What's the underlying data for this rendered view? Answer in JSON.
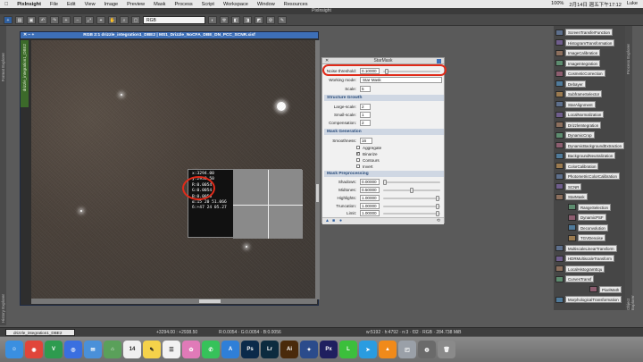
{
  "menubar": {
    "app": "PixInsight",
    "items": [
      "File",
      "Edit",
      "View",
      "Image",
      "Preview",
      "Mask",
      "Process",
      "Script",
      "Workspace",
      "Window",
      "Resources"
    ],
    "clock": "2月14日 週五下午17:12",
    "user": "Luke",
    "battery": "100%"
  },
  "window_title": "PixInsight",
  "toolbar": {
    "channel_select": "RGB"
  },
  "left_strip": {
    "top_label": "Format Explorer",
    "bottom_label": "History Explorer"
  },
  "image_window": {
    "title": "RGB 2:1 drizzle_integration1_DBE2 | MS1_Drizzle_NoCFA_DBE_DN_PCC_SCNR.xisf",
    "side_tab": "drizzle_integration1_DBE2",
    "readout_lines": [
      "x:3294.00",
      "y:2938.50",
      "R:0.0054",
      "G:0.0054",
      "B:0.0056",
      "α:15 20 51.066",
      "δ:+47 24 05.27"
    ]
  },
  "starmask": {
    "title": "StarMask",
    "noise_threshold_label": "Noise threshold:",
    "noise_threshold": "0.10000",
    "working_mode_label": "Working mode:",
    "working_mode": "Star Mask",
    "scale_label": "Scale:",
    "scale": "5",
    "section_structure": "Structure Growth",
    "large_scale_label": "Large-scale:",
    "large_scale": "2",
    "small_scale_label": "Small-scale:",
    "small_scale": "1",
    "compensation_label": "Compensation:",
    "compensation": "2",
    "section_mask_gen": "Mask Generation",
    "smoothness_label": "Smoothness:",
    "smoothness": "16",
    "aggregate_label": "Aggregate",
    "binarize_label": "Binarize",
    "contours_label": "Contours",
    "invert_label": "Invert",
    "section_preproc": "Mask Preprocessing",
    "shadows_label": "Shadows:",
    "shadows": "0.00000",
    "midtones_label": "Midtones:",
    "midtones": "0.50000",
    "highlights_label": "Highlights:",
    "highlights": "1.00000",
    "truncation_label": "Truncation:",
    "truncation": "1.00000",
    "limit_label": "Limit:",
    "limit": "1.00000"
  },
  "process_panel": {
    "items": [
      "ScreenTransferFunction",
      "HistogramTransformation",
      "ImageCalibration",
      "ImageIntegration",
      "CosmeticCorrection",
      "Debayer",
      "SubframeSelector",
      "StarAlignment",
      "LocalNormalization",
      "DrizzleIntegration",
      "DynamicCrop",
      "DynamicBackgroundExtraction",
      "BackgroundNeutralization",
      "ColorCalibration",
      "PhotometricColorCalibration",
      "SCNR",
      "StarMask",
      "RangeSelection",
      "DynamicPSF",
      "Deconvolution",
      "TGVDenoise",
      "MultiscaleLinearTransform",
      "HDRMultiscaleTransform",
      "LocalHistogramEqu",
      "CurvesTransf",
      "PixelMath",
      "MorphologicalTransformation"
    ],
    "side_labels": [
      "Process Explorer",
      "Object Explorer"
    ]
  },
  "statusbar": {
    "view": "drizzle_integration1_DBE2",
    "coords": "+3294.00 : +2938.50",
    "values": "R:0.0054 · G:0.0054 · B:0.0056",
    "info": "w:5192 · h:4792 · n:3 · f32 · RGB · 284.738 MiB"
  },
  "dock": [
    "Finder",
    "Chrome",
    "Vim",
    "Safari",
    "Mail",
    "Maps",
    "Calendar",
    "Notes",
    "Reminders",
    "Photos",
    "Messages",
    "App Store",
    "Photoshop",
    "Lightroom",
    "Illustrator",
    "Pixel",
    "PixInsight",
    "LINE",
    "Telegram",
    "VLC",
    "Preview",
    "Disk",
    "Trash"
  ]
}
